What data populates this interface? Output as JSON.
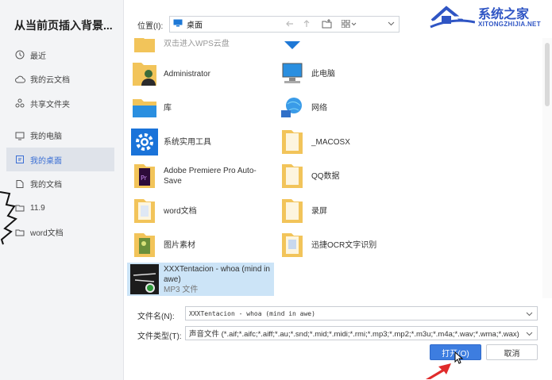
{
  "dialog": {
    "title": "从当前页插入背景..."
  },
  "sidebar": {
    "items": [
      {
        "label": "最近",
        "icon": "clock-icon"
      },
      {
        "label": "我的云文档",
        "icon": "cloud-icon"
      },
      {
        "label": "共享文件夹",
        "icon": "share-icon"
      },
      {
        "label": "我的电脑",
        "icon": "monitor-icon"
      },
      {
        "label": "我的桌面",
        "icon": "desktop-icon",
        "active": true
      },
      {
        "label": "我的文档",
        "icon": "document-icon"
      },
      {
        "label": "11.9",
        "icon": "folder-icon"
      },
      {
        "label": "word文档",
        "icon": "folder-icon"
      }
    ]
  },
  "toolbar": {
    "location_label": "位置(I):",
    "location_value": "桌面"
  },
  "watermark": {
    "text": "系统之家",
    "sub": "XITONGZHIJIA.NET"
  },
  "files": [
    {
      "name": "双击进入WPS云盘",
      "icon": "cloud-folder-icon"
    },
    {
      "name": "",
      "icon": "wps-cloud-icon"
    },
    {
      "name": "Administrator",
      "icon": "user-folder-icon"
    },
    {
      "name": "此电脑",
      "icon": "computer-icon"
    },
    {
      "name": "库",
      "icon": "library-icon"
    },
    {
      "name": "网络",
      "icon": "network-icon"
    },
    {
      "name": "系统实用工具",
      "icon": "gear-icon"
    },
    {
      "name": "_MACOSX",
      "icon": "folder-icon"
    },
    {
      "name": "Adobe Premiere Pro Auto-Save",
      "icon": "premiere-folder-icon"
    },
    {
      "name": "QQ数据",
      "icon": "folder-icon"
    },
    {
      "name": "word文档",
      "icon": "folder-icon"
    },
    {
      "name": "录屏",
      "icon": "folder-icon"
    },
    {
      "name": "图片素材",
      "icon": "image-folder-icon"
    },
    {
      "name": "迅捷OCR文字识别",
      "icon": "folder-icon"
    },
    {
      "name": "XXXTentacion - whoa (mind in awe)",
      "sub": "MP3 文件",
      "icon": "album-art-icon",
      "selected": true
    }
  ],
  "form": {
    "filename_label": "文件名(N):",
    "filename_value": "XXXTentacion - whoa (mind in awe)",
    "filetype_label": "文件类型(T):",
    "filetype_value": "声音文件 (*.aif;*.aifc;*.aiff;*.au;*.snd;*.mid;*.midi;*.rmi;*.mp3;*.mp2;*.m3u;*.m4a;*.wav;*.wma;*.wax)",
    "open_label": "打开(O)",
    "cancel_label": "取消"
  },
  "colors": {
    "accent": "#3d7de0",
    "selected_bg": "#cce4f7",
    "sidebar_active": "#dfe3ea",
    "folder": "#f2c45a"
  }
}
